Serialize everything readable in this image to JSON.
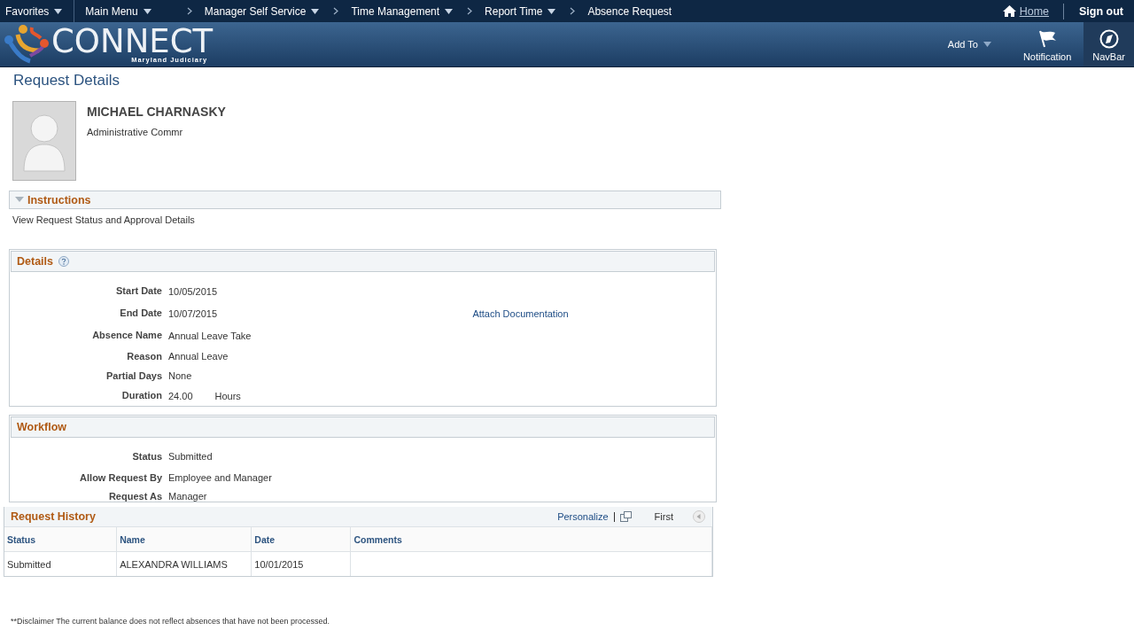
{
  "nav": {
    "menus": [
      {
        "label": "Favorites",
        "dropdown": true,
        "chevron": false
      },
      {
        "label": "Main Menu",
        "dropdown": true,
        "chevron": false
      },
      {
        "label": "Manager Self Service",
        "dropdown": true,
        "chevron": true
      },
      {
        "label": "Time Management",
        "dropdown": true,
        "chevron": true
      },
      {
        "label": "Report Time",
        "dropdown": true,
        "chevron": true
      },
      {
        "label": "Absence Request",
        "dropdown": false,
        "chevron": true
      }
    ],
    "home": "Home",
    "sign_out": "Sign out"
  },
  "header": {
    "logo": "CONNECT",
    "logo_sub": "Maryland Judiciary",
    "actions": [
      {
        "label": "Add To",
        "kind": "dropdown"
      },
      {
        "label": "Notification",
        "kind": "flag"
      },
      {
        "label": "NavBar",
        "kind": "compass"
      }
    ]
  },
  "page_title": "Request Details",
  "employee": {
    "name": "MICHAEL CHARNASKY",
    "title": "Administrative Commr"
  },
  "instructions": {
    "title": "Instructions",
    "expanded": true,
    "text": "View Request Status and Approval Details"
  },
  "details": {
    "title": "Details",
    "fields": [
      {
        "label": "Start Date",
        "value": "10/05/2015"
      },
      {
        "label": "End Date",
        "value": "10/07/2015",
        "link": "Attach Documentation"
      },
      {
        "label": "Absence Name",
        "value": "Annual Leave Take"
      },
      {
        "label": "Reason",
        "value": "Annual Leave"
      },
      {
        "label": "Partial Days",
        "value": "None"
      },
      {
        "label": "Duration",
        "value": "24.00",
        "unit": "Hours"
      }
    ]
  },
  "workflow": {
    "title": "Workflow",
    "fields": [
      {
        "label": "Status",
        "value": "Submitted"
      },
      {
        "label": "Allow Request By",
        "value": "Employee and Manager"
      },
      {
        "label": "Request As",
        "value": "Manager"
      }
    ]
  },
  "history": {
    "title": "Request History",
    "personalize": "Personalize",
    "first": "First",
    "columns": [
      "Status",
      "Name",
      "Date",
      "Comments"
    ],
    "rows": [
      [
        "Submitted",
        "ALEXANDRA WILLIAMS",
        "10/01/2015",
        ""
      ]
    ]
  },
  "disclaimer": "**Disclaimer  The current balance does not reflect absences that have not been processed."
}
